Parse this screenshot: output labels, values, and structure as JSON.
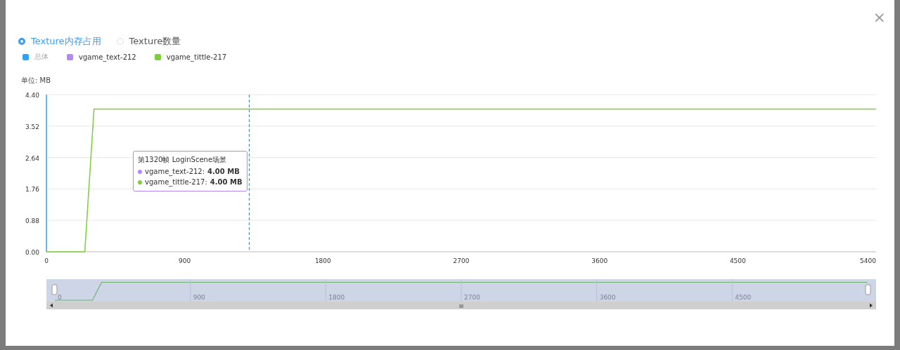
{
  "dialog": {
    "close": "×"
  },
  "radios": [
    {
      "label": "Texture内存占用",
      "selected": true
    },
    {
      "label": "Texture数量",
      "selected": false
    }
  ],
  "legend": [
    {
      "name": "总体",
      "color": "#2ea1f8",
      "on": false
    },
    {
      "name": "vgame_text-212",
      "color": "#b388f5",
      "on": true
    }
  ],
  "chart_data": {
    "type": "line",
    "ylabel": "单位: MB",
    "x": [
      0,
      250,
      310,
      5400
    ],
    "series": [
      {
        "name": "vgame_tittle-217",
        "color": "#7ccf3a",
        "values": [
          0,
          0,
          4,
          4
        ]
      }
    ],
    "grid": true,
    "xlim": [
      0,
      5400
    ],
    "ylim": [
      0,
      4.4
    ],
    "xticks": [
      0,
      900,
      1800,
      2700,
      3600,
      4500,
      5400
    ],
    "yticks": [
      {
        "value": 0,
        "label": "0.00"
      },
      {
        "value": 0.88,
        "label": "0.88"
      },
      {
        "value": 1.76,
        "label": "1.76"
      },
      {
        "value": 2.64,
        "label": "2.64"
      },
      {
        "value": 3.52,
        "label": "3.52"
      },
      {
        "value": 4.4,
        "label": "4.40"
      }
    ],
    "ref_lines": [
      {
        "axis": "x",
        "value": 1320
      }
    ]
  },
  "tooltip": {
    "title": "第1320帧 LoginScene场景",
    "rows": [
      {
        "name": "vgame_text-212:",
        "value": "4.00 MB",
        "color": "#b388f5"
      },
      {
        "name": "vgame_tittle-217:",
        "value": "4.00 MB",
        "color": "#7ccf3a"
      }
    ]
  },
  "zoom_slider": {
    "labels": [
      "0",
      "900",
      "1800",
      "2700",
      "3600",
      "4500"
    ],
    "scroll_grip": "III"
  }
}
